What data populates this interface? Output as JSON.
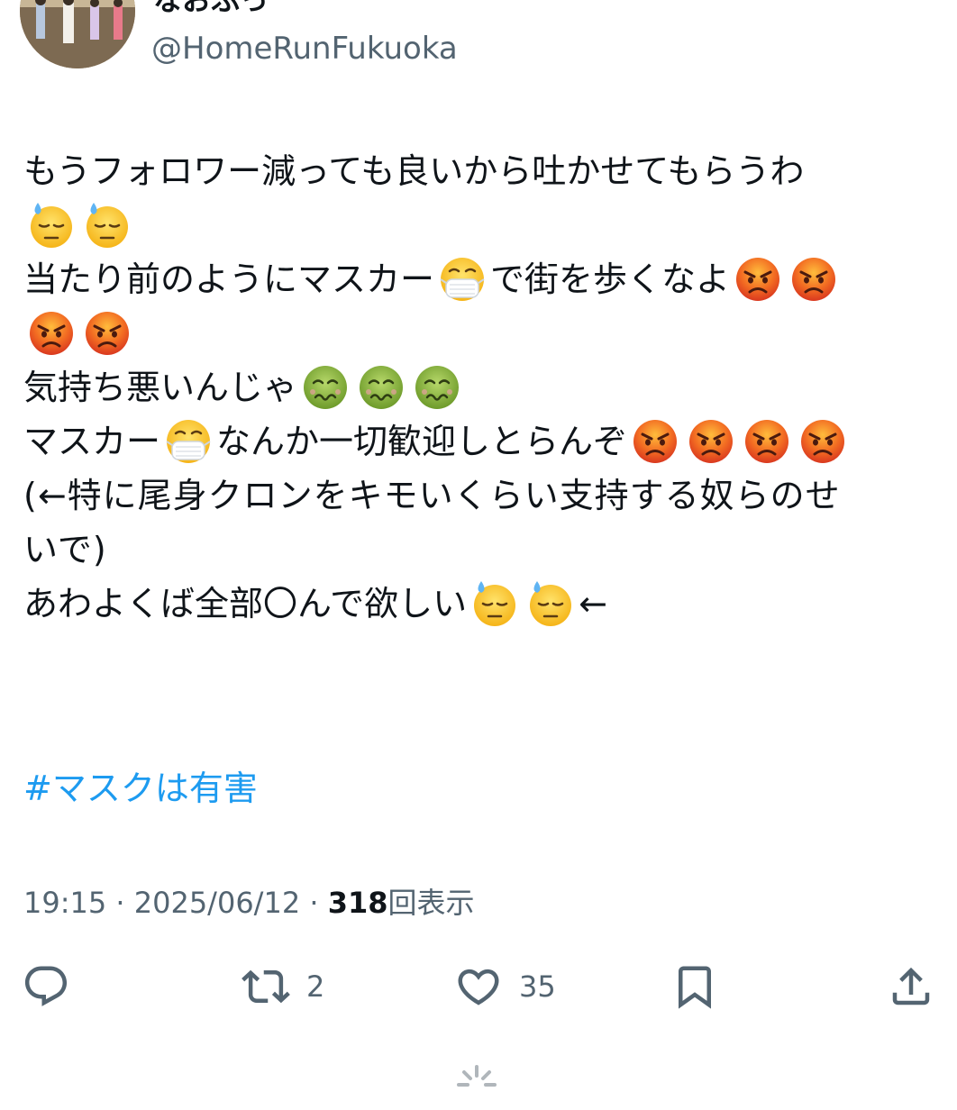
{
  "user": {
    "display_name": "なおふっ",
    "handle": "@HomeRunFukuoka"
  },
  "tweet": {
    "lines": [
      {
        "text": "もうフォロワー減っても良いから吐かせてもらうわ",
        "emojis_after": []
      },
      {
        "text": "",
        "emojis_after": [
          "downcast-sweat-emoji",
          "downcast-sweat-emoji"
        ]
      },
      {
        "text_a": "当たり前のようにマスカー",
        "mid_emoji": "mask-emoji",
        "text_b": "で街を歩くなよ",
        "emojis_after": [
          "angry-emoji",
          "angry-emoji"
        ]
      },
      {
        "text": "",
        "emojis_after": [
          "angry-emoji",
          "angry-emoji"
        ]
      },
      {
        "text": "気持ち悪いんじゃ",
        "emojis_after": [
          "nauseated-emoji",
          "nauseated-emoji",
          "nauseated-emoji"
        ]
      },
      {
        "text_a": "マスカー",
        "mid_emoji": "mask-emoji",
        "text_b": "なんか一切歓迎しとらんぞ",
        "emojis_after": [
          "angry-emoji",
          "angry-emoji",
          "angry-emoji",
          "angry-emoji"
        ]
      },
      {
        "text": "(←特に尾身クロンをキモいくらい支持する奴らのせ",
        "emojis_after": []
      },
      {
        "text": "いで)",
        "emojis_after": []
      },
      {
        "text": "あわよくば全部〇んで欲しい",
        "emojis_after": [
          "downcast-sweat-emoji",
          "downcast-sweat-emoji"
        ],
        "trailing": "←"
      }
    ],
    "hashtag": "#マスクは有害",
    "time": "19:15 · 2025/06/12 · ",
    "views_count": "318",
    "views_label": "回表示"
  },
  "actions": {
    "retweets": "2",
    "likes": "35"
  },
  "colors": {
    "link": "#1d9bf0",
    "muted": "#536471",
    "text": "#0f1419"
  }
}
